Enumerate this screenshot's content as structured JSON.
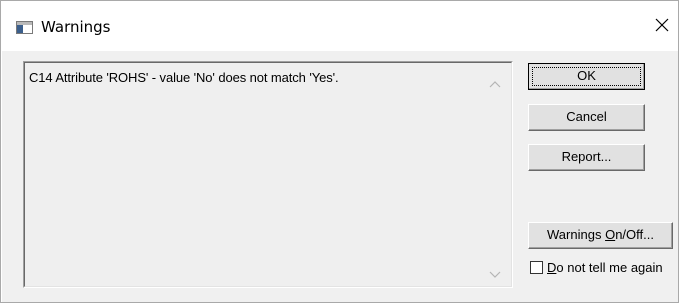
{
  "window": {
    "title": "Warnings"
  },
  "warnings_list": {
    "items": [
      "C14 Attribute 'ROHS' - value 'No' does not match 'Yes'."
    ]
  },
  "buttons": {
    "ok": "OK",
    "cancel": "Cancel",
    "report": "Report...",
    "warnings_toggle": {
      "before": "Warnings ",
      "underlined": "O",
      "after": "n/Off..."
    }
  },
  "checkbox": {
    "label_underlined": "D",
    "label_rest": "o not tell me again",
    "checked": false
  },
  "icons": {
    "title": "window-app-icon",
    "close": "close-icon",
    "scroll_up": "chevron-up-icon",
    "scroll_down": "chevron-down-icon"
  }
}
